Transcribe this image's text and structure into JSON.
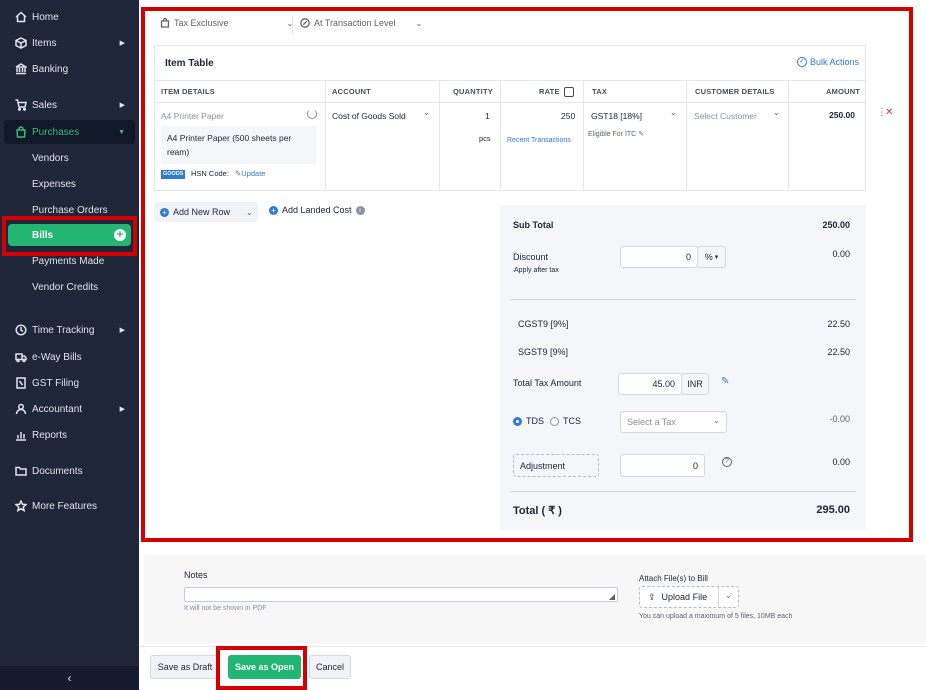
{
  "sidebar": {
    "items": [
      {
        "label": "Home",
        "icon": "home-icon"
      },
      {
        "label": "Items",
        "icon": "cube-icon"
      },
      {
        "label": "Banking",
        "icon": "bank-icon"
      },
      {
        "label": "Sales",
        "icon": "cart-icon"
      },
      {
        "label": "Purchases",
        "icon": "bag-icon"
      },
      {
        "label": "Vendors"
      },
      {
        "label": "Expenses"
      },
      {
        "label": "Purchase Orders"
      },
      {
        "label": "Bills"
      },
      {
        "label": "Payments Made"
      },
      {
        "label": "Vendor Credits"
      },
      {
        "label": "Time Tracking",
        "icon": "clock-icon"
      },
      {
        "label": "e-Way Bills",
        "icon": "truck-icon"
      },
      {
        "label": "GST Filing",
        "icon": "file-icon"
      },
      {
        "label": "Accountant",
        "icon": "user-icon"
      },
      {
        "label": "Reports",
        "icon": "chart-icon"
      },
      {
        "label": "Documents",
        "icon": "folder-icon"
      },
      {
        "label": "More Features",
        "icon": "star-icon"
      }
    ],
    "collapse_glyph": "‹"
  },
  "top_controls": {
    "tax_mode": "Tax Exclusive",
    "discount_level": "At Transaction Level"
  },
  "item_table": {
    "title": "Item Table",
    "bulk_actions": "Bulk Actions",
    "columns": [
      "ITEM DETAILS",
      "ACCOUNT",
      "QUANTITY",
      "RATE",
      "TAX",
      "CUSTOMER DETAILS",
      "AMOUNT"
    ],
    "row": {
      "item_name": "A4 Printer Paper",
      "item_description": "A4 Printer Paper (500 sheets per ream)",
      "goods_badge": "GOODS",
      "hsn_label": "HSN Code:",
      "hsn_update": "Update",
      "account": "Cost of Goods Sold",
      "quantity": "1",
      "unit": "pcs",
      "rate": "250",
      "recent_transactions": "Recent Transactions",
      "tax": "GST18 [18%]",
      "itc": "Eligible For ITC",
      "customer_placeholder": "Select Customer",
      "amount": "250.00"
    }
  },
  "actions": {
    "add_new_row": "Add New Row",
    "add_landed_cost": "Add Landed Cost"
  },
  "totals": {
    "sub_total_label": "Sub Total",
    "sub_total": "250.00",
    "discount_label": "Discount",
    "apply_after_tax": "Apply after tax",
    "discount_value": "0",
    "discount_unit": "%",
    "discount_amount": "0.00",
    "cgst_label": "CGST9 [9%]",
    "cgst": "22.50",
    "sgst_label": "SGST9 [9%]",
    "sgst": "22.50",
    "total_tax_label": "Total Tax Amount",
    "total_tax_value": "45.00",
    "currency": "INR",
    "tds_label": "TDS",
    "tcs_label": "TCS",
    "select_tax_placeholder": "Select a Tax",
    "tds_amount": "-0.00",
    "adjustment_label": "Adjustment",
    "adjustment_value": "0",
    "adjustment_amount": "0.00",
    "total_label": "Total ( ₹ )",
    "total": "295.00"
  },
  "notes": {
    "label": "Notes",
    "hint": "It will not be shown in PDF"
  },
  "attach": {
    "label": "Attach File(s) to Bill",
    "upload": "Upload File",
    "hint": "You can upload a maximum of 5 files, 10MB each"
  },
  "footer": {
    "save_draft": "Save as Draft",
    "save_open": "Save as Open",
    "cancel": "Cancel"
  },
  "colors": {
    "sidebar_bg": "#1f2639",
    "accent_green": "#22b573",
    "link_blue": "#2f7ad5",
    "highlight_red": "#d40000"
  }
}
